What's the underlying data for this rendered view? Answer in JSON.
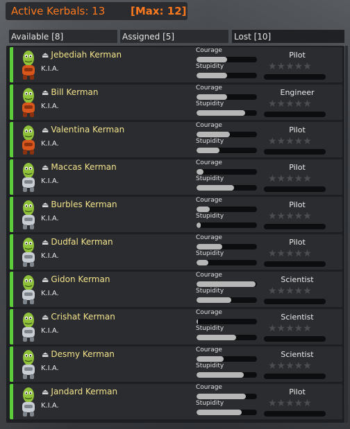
{
  "header": {
    "title": "Active Kerbals: 13",
    "max": "[Max: 12]"
  },
  "tabs": [
    {
      "label": "Available [8]"
    },
    {
      "label": "Assigned [5]"
    },
    {
      "label": "Lost [10]"
    }
  ],
  "labels": {
    "courage": "Courage",
    "stupidity": "Stupidity"
  },
  "stars_glyph": "★★★★★",
  "colors": {
    "accent": "#ff7a1f",
    "name": "#f3e38b",
    "status_stripe": "#5dcc3a"
  },
  "kerbals": [
    {
      "name": "Jebediah Kerman",
      "status": "K.I.A.",
      "trait": "Pilot",
      "courage": 0.5,
      "stupidity": 0.5,
      "suit": "orange",
      "stars": 0
    },
    {
      "name": "Bill Kerman",
      "status": "K.I.A.",
      "trait": "Engineer",
      "courage": 0.5,
      "stupidity": 0.8,
      "suit": "orange",
      "stars": 0
    },
    {
      "name": "Valentina Kerman",
      "status": "K.I.A.",
      "trait": "Pilot",
      "courage": 0.55,
      "stupidity": 0.38,
      "suit": "orange",
      "stars": 0
    },
    {
      "name": "Maccas Kerman",
      "status": "K.I.A.",
      "trait": "Pilot",
      "courage": 0.12,
      "stupidity": 0.62,
      "suit": "white",
      "stars": 0
    },
    {
      "name": "Burbles Kerman",
      "status": "K.I.A.",
      "trait": "Pilot",
      "courage": 0.22,
      "stupidity": 0.07,
      "suit": "white",
      "stars": 0
    },
    {
      "name": "Dudfal Kerman",
      "status": "K.I.A.",
      "trait": "Pilot",
      "courage": 0.42,
      "stupidity": 0.2,
      "suit": "white",
      "stars": 0
    },
    {
      "name": "Gidon Kerman",
      "status": "K.I.A.",
      "trait": "Scientist",
      "courage": 0.98,
      "stupidity": 0.57,
      "suit": "white",
      "stars": 0
    },
    {
      "name": "Crishat Kerman",
      "status": "K.I.A.",
      "trait": "Scientist",
      "courage": 0.02,
      "stupidity": 0.65,
      "suit": "white",
      "stars": 0
    },
    {
      "name": "Desmy Kerman",
      "status": "K.I.A.",
      "trait": "Scientist",
      "courage": 0.45,
      "stupidity": 0.78,
      "suit": "white",
      "stars": 0
    },
    {
      "name": "Jandard Kerman",
      "status": "K.I.A.",
      "trait": "Pilot",
      "courage": 0.82,
      "stupidity": 0.75,
      "suit": "white",
      "stars": 0
    }
  ]
}
